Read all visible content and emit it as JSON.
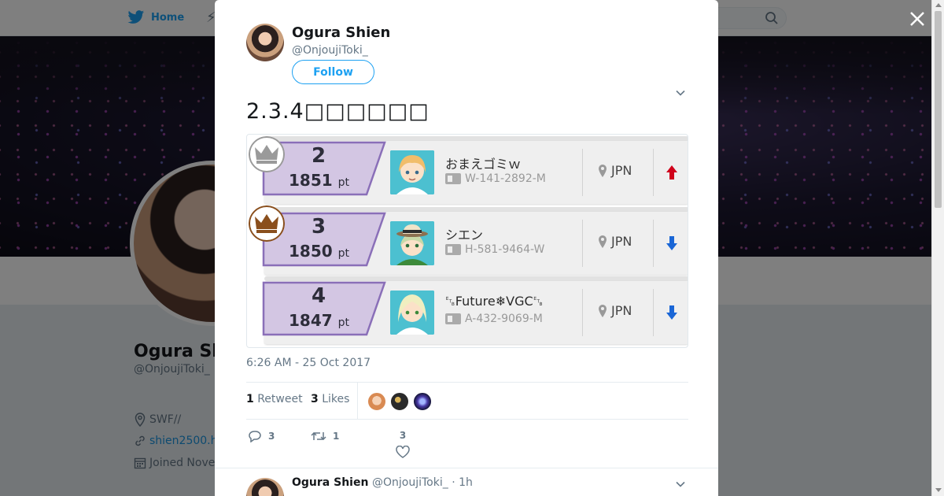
{
  "nav": {
    "home_label": "Home"
  },
  "profile": {
    "name": "Ogura Sh",
    "handle": "@OnjoujiToki_",
    "location": "SWF//",
    "website": "shien2500.h",
    "joined": "Joined Nove"
  },
  "tweet": {
    "author_name": "Ogura Shien",
    "author_handle": "@OnjoujiToki_",
    "follow_label": "Follow",
    "text": "2.3.4□□□□□□",
    "timestamp": "6:26 AM - 25 Oct 2017",
    "retweets_count": "1",
    "retweets_label": "Retweet",
    "likes_count": "3",
    "likes_label": "Likes",
    "replies_action_count": "3",
    "retweets_action_count": "1",
    "likes_action_count": "3"
  },
  "ranking": {
    "rows": [
      {
        "rank": "2",
        "points": "1851",
        "unit": "pt",
        "name": "おまえゴミｗ",
        "id": "W-141-2892-M",
        "region": "JPN",
        "trend": "up",
        "crown": "silver"
      },
      {
        "rank": "3",
        "points": "1850",
        "unit": "pt",
        "name": "シエン",
        "id": "H-581-9464-W",
        "region": "JPN",
        "trend": "down",
        "crown": "bronze"
      },
      {
        "rank": "4",
        "points": "1847",
        "unit": "pt",
        "name": "␗Future❄VGC␗",
        "id": "A-432-9069-M",
        "region": "JPN",
        "trend": "down",
        "crown": "none"
      }
    ]
  },
  "reply": {
    "author_name": "Ogura Shien",
    "author_handle": "@OnjoujiToki_",
    "time": "1h"
  },
  "colors": {
    "twitter_blue": "#1da1f2",
    "points_purple": "#d3c6e3",
    "trend_up": "#d0021b",
    "trend_down": "#1a66d6"
  }
}
